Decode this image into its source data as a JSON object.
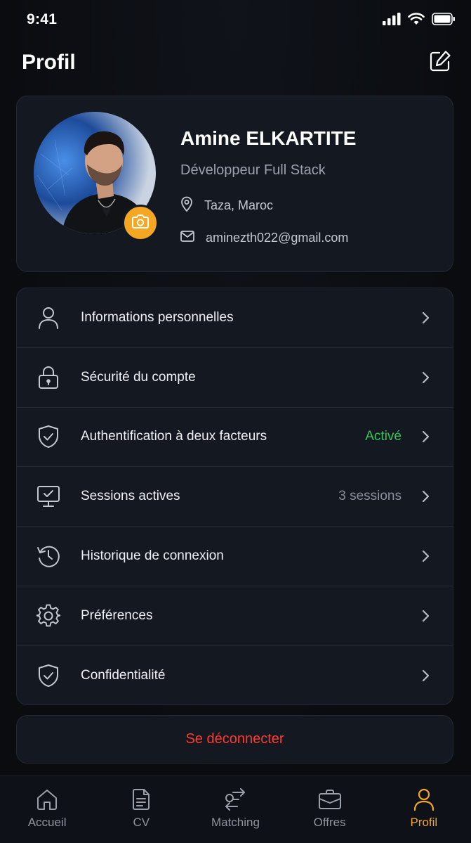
{
  "status_bar": {
    "time": "9:41",
    "icons": [
      "signal-icon",
      "wifi-icon",
      "battery-icon"
    ]
  },
  "header": {
    "title": "Profil",
    "edit_icon": "edit-icon"
  },
  "profile": {
    "name": "Amine ELKARTITE",
    "role": "Développeur Full Stack",
    "location": "Taza, Maroc",
    "email": "aminezth022@gmail.com",
    "camera_icon": "camera-icon"
  },
  "menu": {
    "items": [
      {
        "label": "Informations personnelles",
        "icon": "user-icon",
        "meta": ""
      },
      {
        "label": "Sécurité du compte",
        "icon": "lock-icon",
        "meta": ""
      },
      {
        "label": "Authentification à deux facteurs",
        "icon": "shield-check-icon",
        "meta": "Activé"
      },
      {
        "label": "Sessions actives",
        "icon": "monitor-check-icon",
        "meta": "3 sessions"
      },
      {
        "label": "Historique de connexion",
        "icon": "history-icon",
        "meta": ""
      },
      {
        "label": "Préférences",
        "icon": "gear-icon",
        "meta": ""
      },
      {
        "label": "Confidentialité",
        "icon": "shield-check-icon",
        "meta": ""
      }
    ]
  },
  "logout": {
    "label": "Se déconnecter"
  },
  "tab_bar": {
    "tabs": [
      {
        "label": "Accueil",
        "icon": "home-icon",
        "active": false
      },
      {
        "label": "CV",
        "icon": "document-icon",
        "active": false
      },
      {
        "label": "Matching",
        "icon": "matching-icon",
        "active": false
      },
      {
        "label": "Offres",
        "icon": "briefcase-icon",
        "active": false
      },
      {
        "label": "Profil",
        "icon": "user-icon",
        "active": true
      }
    ]
  },
  "colors": {
    "accent": "#f5a623",
    "success": "#34c759",
    "danger": "#ff3b30",
    "card_background": "#141820"
  }
}
